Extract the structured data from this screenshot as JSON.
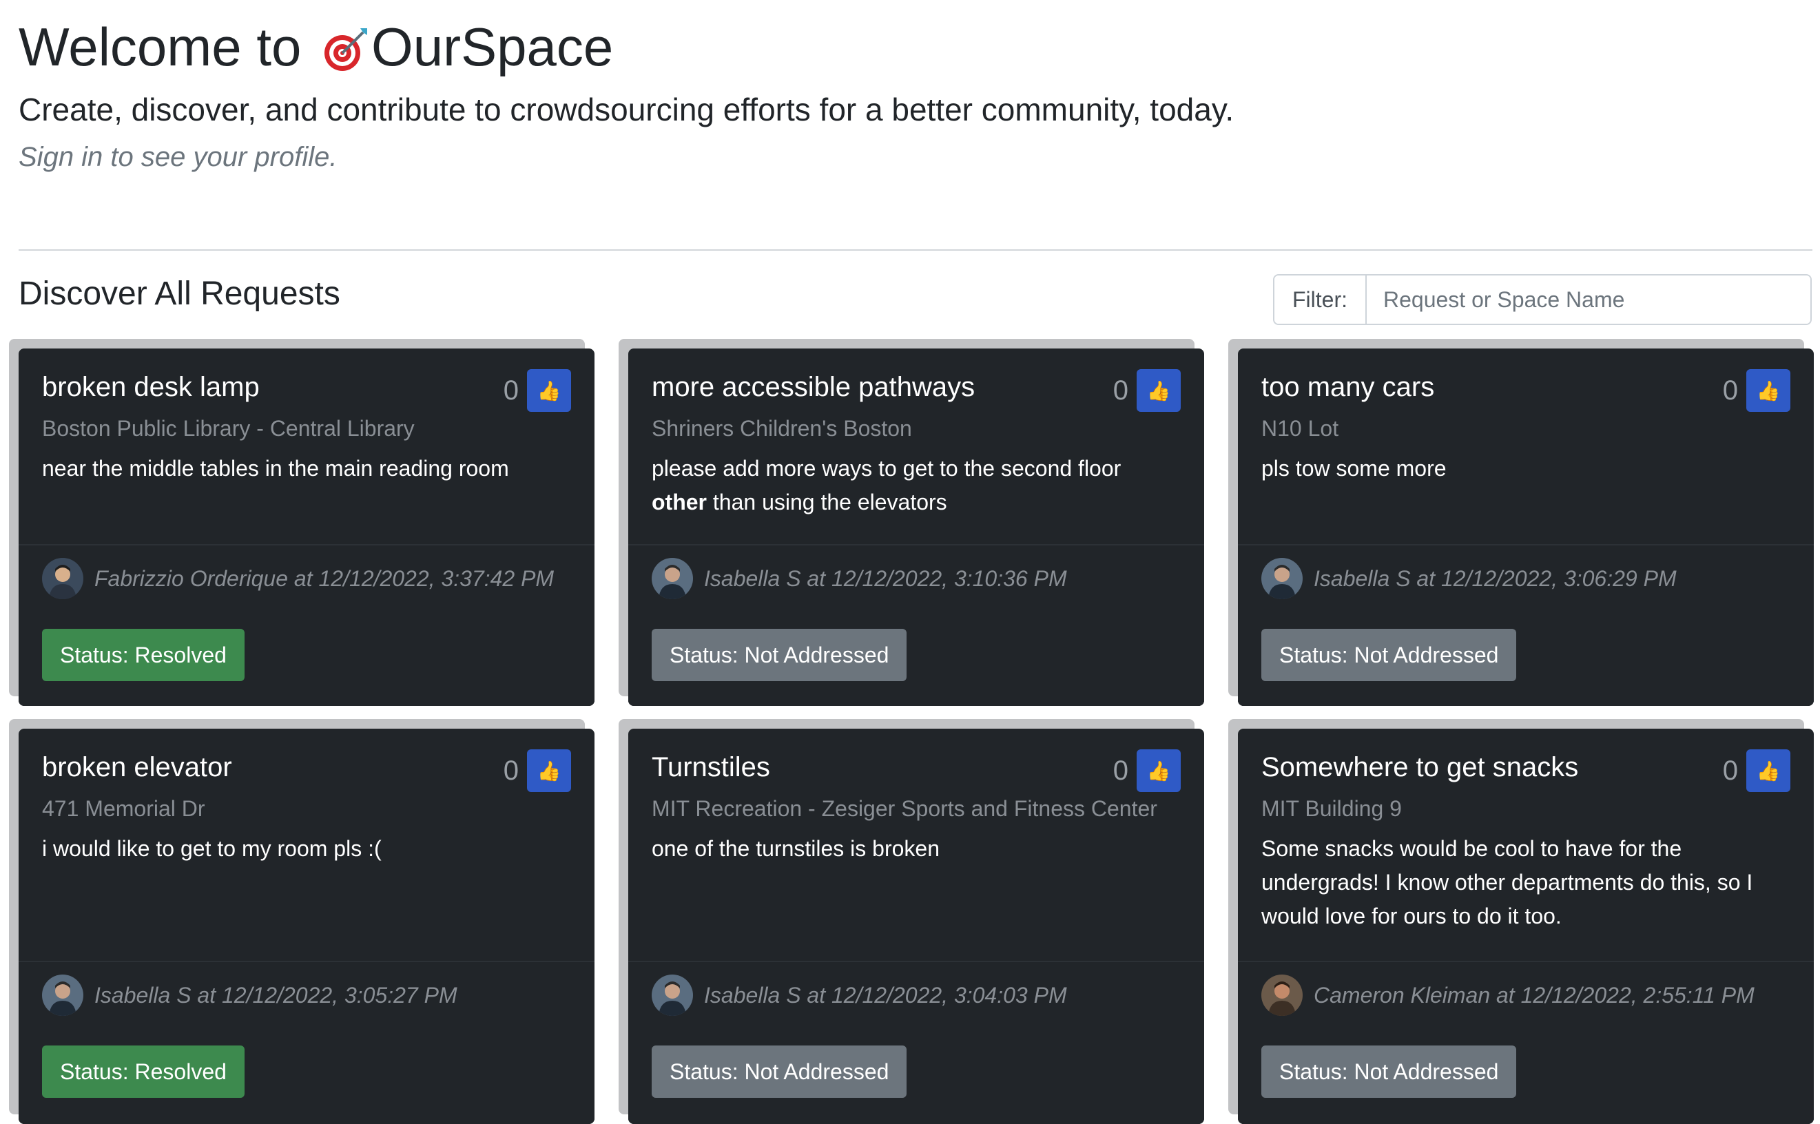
{
  "header": {
    "title_prefix": "Welcome to ",
    "logo_icon": "target-dart-icon",
    "title_brand": "OurSpace",
    "subtitle": "Create, discover, and contribute to crowdsourcing efforts for a better community, today.",
    "signin_note": "Sign in to see your profile."
  },
  "discover": {
    "title": "Discover All Requests",
    "filter_label": "Filter:",
    "filter_placeholder": "Request or Space Name",
    "filter_value": ""
  },
  "colors": {
    "card_bg": "#212529",
    "resolved": "#3d8a4e",
    "not_addressed": "#6c757d",
    "vote_button": "#2f5ac6"
  },
  "cards": [
    {
      "title": "broken desk lamp",
      "votes": "0",
      "space": "Boston Public Library - Central Library",
      "desc_parts": [
        "near the middle tables in the main reading room"
      ],
      "author": "Fabrizzio Orderique at 12/12/2022, 3:37:42 PM",
      "status": "Status: Resolved",
      "status_kind": "resolved"
    },
    {
      "title": "more accessible pathways",
      "votes": "0",
      "space": "Shriners Children's Boston",
      "desc_parts": [
        "please add more ways to get to the second floor ",
        "other",
        " than using the elevators"
      ],
      "author": "Isabella S at 12/12/2022, 3:10:36 PM",
      "status": "Status: Not Addressed",
      "status_kind": "notaddr"
    },
    {
      "title": "too many cars",
      "votes": "0",
      "space": "N10 Lot",
      "desc_parts": [
        "pls tow some more"
      ],
      "author": "Isabella S at 12/12/2022, 3:06:29 PM",
      "status": "Status: Not Addressed",
      "status_kind": "notaddr"
    },
    {
      "title": "broken elevator",
      "votes": "0",
      "space": "471 Memorial Dr",
      "desc_parts": [
        "i would like to get to my room pls :("
      ],
      "author": "Isabella S at 12/12/2022, 3:05:27 PM",
      "status": "Status: Resolved",
      "status_kind": "resolved"
    },
    {
      "title": "Turnstiles",
      "votes": "0",
      "space": "MIT Recreation - Zesiger Sports and Fitness Center",
      "desc_parts": [
        "one of the turnstiles is broken"
      ],
      "author": "Isabella S at 12/12/2022, 3:04:03 PM",
      "status": "Status: Not Addressed",
      "status_kind": "notaddr"
    },
    {
      "title": "Somewhere to get snacks",
      "votes": "0",
      "space": "MIT Building 9",
      "desc_parts": [
        "Some snacks would be cool to have for the undergrads! I know other departments do this, so I would love for ours to do it too."
      ],
      "author": "Cameron Kleiman at 12/12/2022, 2:55:11 PM",
      "status": "Status: Not Addressed",
      "status_kind": "notaddr"
    }
  ]
}
